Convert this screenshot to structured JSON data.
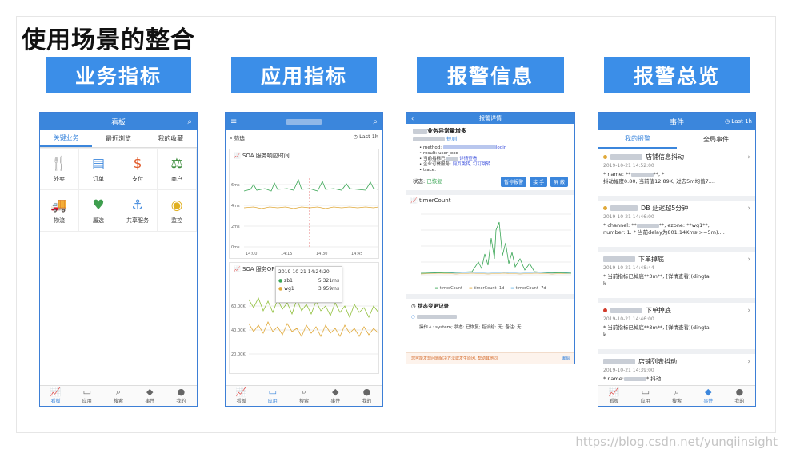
{
  "slide_title": "使用场景的整合",
  "banners": [
    "业务指标",
    "应用指标",
    "报警信息",
    "报警总览"
  ],
  "p1": {
    "title": "看板",
    "tabs": [
      "关键业务",
      "最近浏览",
      "我的收藏"
    ],
    "grid": [
      {
        "icon": "🍴",
        "label": "外卖",
        "color": "#e08a1e"
      },
      {
        "icon": "▤",
        "label": "订单",
        "color": "#3b86dc"
      },
      {
        "icon": "$",
        "label": "支付",
        "color": "#e05a2a"
      },
      {
        "icon": "⚖",
        "label": "商户",
        "color": "#3e8e3e"
      },
      {
        "icon": "🚚",
        "label": "物流",
        "color": "#3b86dc"
      },
      {
        "icon": "♥",
        "label": "履选",
        "color": "#3e9e4e"
      },
      {
        "icon": "⚓",
        "label": "共享服务",
        "color": "#3b86dc"
      },
      {
        "icon": "◉",
        "label": "监控",
        "color": "#e0b020"
      }
    ],
    "nav": [
      "看板",
      "应用",
      "搜索",
      "事件",
      "我的"
    ]
  },
  "p2": {
    "filter": "筛选",
    "range": "Last 1h",
    "chart1_title": "SOA 服务响应时间",
    "chart1_yticks": [
      "6ms",
      "4ms",
      "2ms",
      "0ms"
    ],
    "chart1_xticks": [
      "14:00",
      "14:15",
      "14:30",
      "14:45"
    ],
    "tooltip": {
      "time": "2019-10-21 14:24:20",
      "rows": [
        {
          "name": "zb1",
          "value": "5.321ms",
          "color": "#3aa655"
        },
        {
          "name": "wg1",
          "value": "3.959ms",
          "color": "#e0a93a"
        }
      ]
    },
    "chart2_title": "SOA 服务QP",
    "chart2_yticks": [
      "60.00K",
      "40.00K",
      "20.00K"
    ],
    "nav": [
      "看板",
      "应用",
      "搜索",
      "事件",
      "我的"
    ]
  },
  "p3": {
    "title": "报警详情",
    "subtitle": "业务异常量增多",
    "rule_link": "规则",
    "bullets": [
      "method:",
      "result: user_exc",
      "当前指标已",
      "企业订餐服务:",
      "trace."
    ],
    "bullet_links": [
      "login",
      "详情查看",
      "网页跳转, 钉钉跳转"
    ],
    "status_label": "状态:",
    "status_value": "已恢复",
    "buttons": [
      "暂停报警",
      "接 手",
      "屏 蔽"
    ],
    "chart_title": "timerCount",
    "legend": [
      {
        "name": "timerCount",
        "color": "#3aa655"
      },
      {
        "name": "timerCount -1d",
        "color": "#e0a93a"
      },
      {
        "name": "timerCount -7d",
        "color": "#6fb7e6"
      }
    ],
    "log_title": "状态变更记录",
    "log_line": "操作人: system; 状态: 已恢复; 指派给: 无; 备注: 无;",
    "notice": "您可能发现问题解决方法或发生原因, 帮助其他同",
    "notice_link": "编辑"
  },
  "p4": {
    "title": "事件",
    "range": "Last 1h",
    "tabs": [
      "我的报警",
      "全局事件"
    ],
    "events": [
      {
        "dot": "#e0a93a",
        "title": "店铺信息抖动",
        "date": "2019-10-21 14:52:00",
        "l1": "* name: **",
        "l1b": "**, *",
        "l2": "抖动幅度0.80, 当前值12.89K, 过去5m均值7...."
      },
      {
        "dot": "#e0a93a",
        "title": "DB 延迟超5分钟",
        "date": "2019-10-21 14:46:00",
        "l1": "* channel: **",
        "l1b": "**, ezone: **wg1**,",
        "l2": "number: 1. * 当前delay为801.14Kms(>=5m)...."
      },
      {
        "dot": "",
        "title": "下单掉底",
        "date": "2019-10-21 14:48:44",
        "l1": "* 当前指标已掉底**3m**, [详情查看](dingtal",
        "l1b": "",
        "l2": "k"
      },
      {
        "dot": "#d23b2b",
        "title": "下单掉底",
        "date": "2019-10-21 14:46:00",
        "l1": "* 当前指标已掉底**3m**, [详情查看](dingtal",
        "l1b": "",
        "l2": "k"
      },
      {
        "dot": "",
        "title": "店铺列表抖动",
        "date": "2019-10-21 14:39:00",
        "l1": "* name:",
        "l1b": "* 抖动",
        "l2": ""
      }
    ],
    "nav": [
      "看板",
      "应用",
      "搜索",
      "事件",
      "我的"
    ]
  },
  "watermark": "https://blog.csdn.net/yunqiinsight"
}
